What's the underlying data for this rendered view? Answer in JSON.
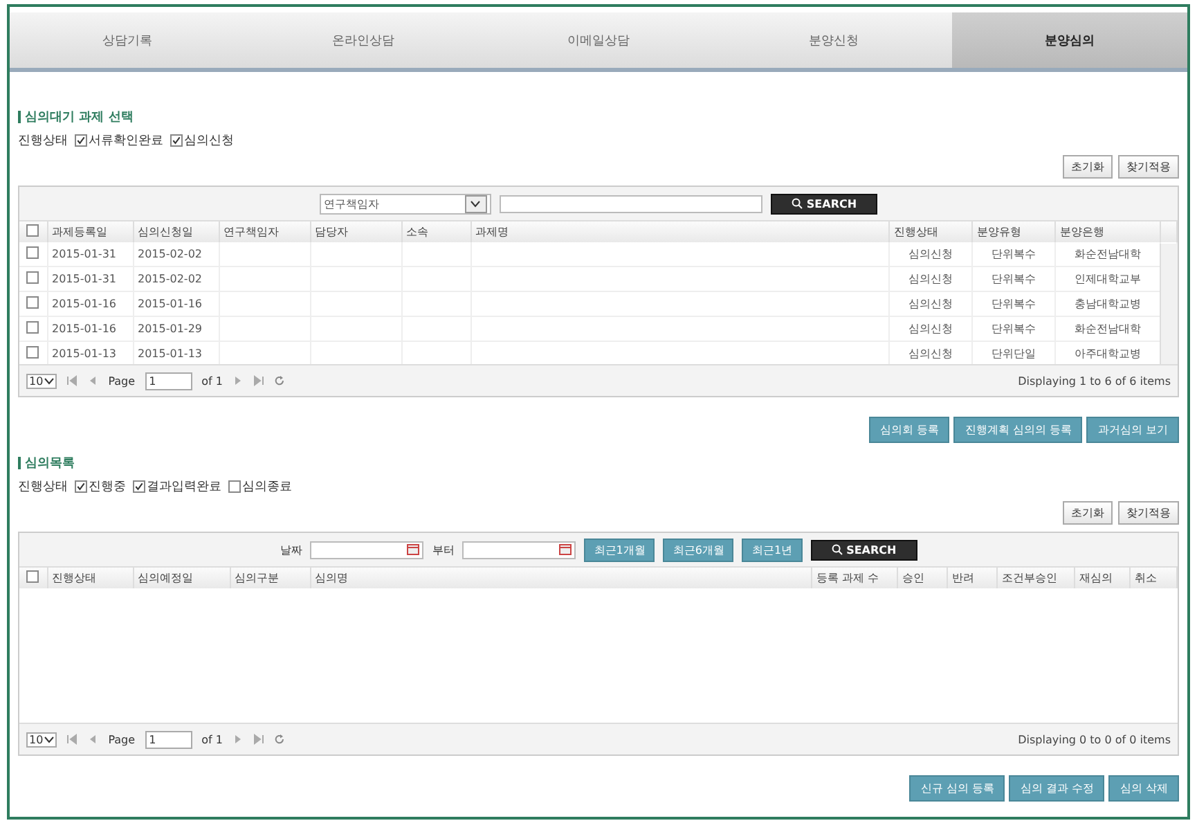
{
  "tabs": [
    {
      "label": "상담기록",
      "selected": false
    },
    {
      "label": "온라인상담",
      "selected": false
    },
    {
      "label": "이메일상담",
      "selected": false
    },
    {
      "label": "분양신청",
      "selected": false
    },
    {
      "label": "분양심의",
      "selected": true
    }
  ],
  "pending": {
    "title": "심의대기 과제 선택",
    "filter_label": "진행상태",
    "filters": [
      {
        "label": "서류확인완료",
        "checked": true
      },
      {
        "label": "심의신청",
        "checked": true
      }
    ],
    "buttons": [
      "초기화",
      "찾기적용"
    ],
    "toolbar": {
      "kind": "keyword",
      "select": "연구책임자",
      "search_button": "SEARCH"
    },
    "select_all_checked": false,
    "columns": [
      "과제등록일",
      "심의신청일",
      "연구책임자",
      "담당자",
      "소속",
      "과제명",
      "진행상태",
      "분양유형",
      "분양은행"
    ],
    "rows": [
      {
        "checked": false,
        "registered": "2015-01-31",
        "requested": "2015-02-02",
        "status": "심의신청",
        "type": "단위복수",
        "bank": "화순전남대학"
      },
      {
        "checked": false,
        "registered": "2015-01-31",
        "requested": "2015-02-02",
        "status": "심의신청",
        "type": "단위복수",
        "bank": "인제대학교부"
      },
      {
        "checked": false,
        "registered": "2015-01-16",
        "requested": "2015-01-16",
        "status": "심의신청",
        "type": "단위복수",
        "bank": "충남대학교병"
      },
      {
        "checked": false,
        "registered": "2015-01-16",
        "requested": "2015-01-29",
        "status": "심의신청",
        "type": "단위복수",
        "bank": "화순전남대학"
      },
      {
        "checked": false,
        "registered": "2015-01-13",
        "requested": "2015-01-13",
        "status": "심의신청",
        "type": "단위단일",
        "bank": "아주대학교병"
      }
    ],
    "pager": {
      "page_size": "10",
      "page_label": "Page",
      "page": "1",
      "of": "of 1",
      "summary": "Displaying 1 to 6 of 6 items"
    },
    "actions": [
      "심의회 등록",
      "진행계획 심의의 등록",
      "과거심의 보기"
    ]
  },
  "reviews": {
    "title": "심의목록",
    "filter_label": "진행상태",
    "filters": [
      {
        "label": "진행중",
        "checked": true
      },
      {
        "label": "결과입력완료",
        "checked": true
      },
      {
        "label": "심의종료",
        "checked": false
      }
    ],
    "buttons": [
      "초기화",
      "찾기적용"
    ],
    "toolbar": {
      "kind": "date",
      "date_label": "날짜",
      "to_label": "부터",
      "range_buttons": [
        "최근1개월",
        "최근6개월",
        "최근1년"
      ],
      "search_button": "SEARCH"
    },
    "select_all_checked": false,
    "columns": [
      "진행상태",
      "심의예정일",
      "심의구분",
      "심의명",
      "등록 과제 수",
      "승인",
      "반려",
      "조건부승인",
      "재심의",
      "취소"
    ],
    "pager": {
      "page_size": "10",
      "page_label": "Page",
      "page": "1",
      "of": "of 1",
      "summary": "Displaying 0 to 0 of 0 items"
    },
    "actions": [
      "신규 심의 등록",
      "심의 결과 수정",
      "심의 삭제"
    ]
  }
}
